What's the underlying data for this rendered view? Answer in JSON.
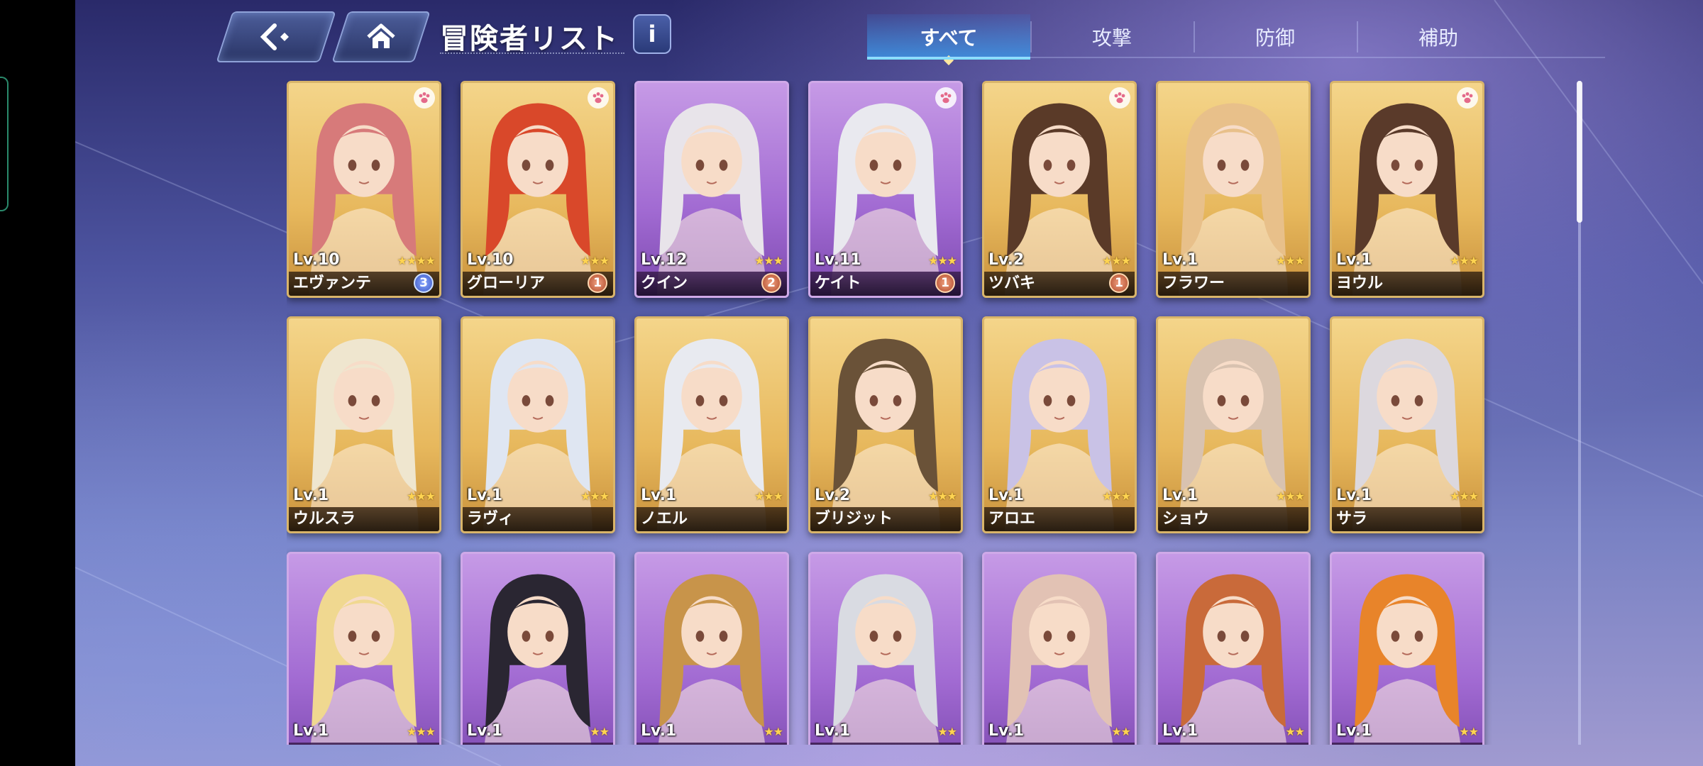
{
  "header": {
    "title": "冒険者リスト",
    "info_label": "i"
  },
  "tabs": [
    {
      "label": "すべて",
      "active": true
    },
    {
      "label": "攻撃",
      "active": false
    },
    {
      "label": "防御",
      "active": false
    },
    {
      "label": "補助",
      "active": false
    }
  ],
  "colors": {
    "gold_card": "#e7b85d",
    "purple_card": "#a16ad2",
    "tab_active": "#3c96e6"
  },
  "cards": [
    {
      "level": "Lv.10",
      "name": "エヴァンテ",
      "stars": "★★★★",
      "badge": "3",
      "badge_style": "blue",
      "paw": true,
      "color": "gold",
      "hair": "#d77a7a"
    },
    {
      "level": "Lv.10",
      "name": "グローリア",
      "stars": "★★★",
      "badge": "1",
      "badge_style": "red",
      "paw": true,
      "color": "gold",
      "hair": "#d9482a"
    },
    {
      "level": "Lv.12",
      "name": "クイン",
      "stars": "★★★",
      "badge": "2",
      "badge_style": "red",
      "paw": false,
      "color": "purple",
      "hair": "#e8e4ea"
    },
    {
      "level": "Lv.11",
      "name": "ケイト",
      "stars": "★★★",
      "badge": "1",
      "badge_style": "red",
      "paw": true,
      "color": "purple",
      "hair": "#e9e9ef"
    },
    {
      "level": "Lv.2",
      "name": "ツバキ",
      "stars": "★★★",
      "badge": "1",
      "badge_style": "red",
      "paw": true,
      "color": "gold",
      "hair": "#5a3a28"
    },
    {
      "level": "Lv.1",
      "name": "フラワー",
      "stars": "★★★",
      "badge": "",
      "badge_style": "",
      "paw": false,
      "color": "gold",
      "hair": "#e8c08a"
    },
    {
      "level": "Lv.1",
      "name": "ヨウル",
      "stars": "★★★",
      "badge": "",
      "badge_style": "",
      "paw": true,
      "color": "gold",
      "hair": "#5a3a2a"
    },
    {
      "level": "Lv.1",
      "name": "ウルスラ",
      "stars": "★★★",
      "badge": "",
      "badge_style": "",
      "paw": false,
      "color": "gold",
      "hair": "#efe6cf"
    },
    {
      "level": "Lv.1",
      "name": "ラヴィ",
      "stars": "★★★",
      "badge": "",
      "badge_style": "",
      "paw": false,
      "color": "gold",
      "hair": "#dfe6f2"
    },
    {
      "level": "Lv.1",
      "name": "ノエル",
      "stars": "★★★",
      "badge": "",
      "badge_style": "",
      "paw": false,
      "color": "gold",
      "hair": "#e8eaf0"
    },
    {
      "level": "Lv.2",
      "name": "ブリジット",
      "stars": "★★★",
      "badge": "",
      "badge_style": "",
      "paw": false,
      "color": "gold",
      "hair": "#6a5238"
    },
    {
      "level": "Lv.1",
      "name": "アロエ",
      "stars": "★★★",
      "badge": "",
      "badge_style": "",
      "paw": false,
      "color": "gold",
      "hair": "#c9c2e6"
    },
    {
      "level": "Lv.1",
      "name": "ショウ",
      "stars": "★★★",
      "badge": "",
      "badge_style": "",
      "paw": false,
      "color": "gold",
      "hair": "#d8c2b0"
    },
    {
      "level": "Lv.1",
      "name": "サラ",
      "stars": "★★★",
      "badge": "",
      "badge_style": "",
      "paw": false,
      "color": "gold",
      "hair": "#dcd8de"
    },
    {
      "level": "Lv.1",
      "name": "",
      "stars": "★★★",
      "badge": "",
      "badge_style": "",
      "paw": false,
      "color": "purple",
      "hair": "#f0d890"
    },
    {
      "level": "Lv.1",
      "name": "",
      "stars": "★★",
      "badge": "",
      "badge_style": "",
      "paw": false,
      "color": "purple",
      "hair": "#2a2632"
    },
    {
      "level": "Lv.1",
      "name": "",
      "stars": "★★",
      "badge": "",
      "badge_style": "",
      "paw": false,
      "color": "purple",
      "hair": "#c8944a"
    },
    {
      "level": "Lv.1",
      "name": "",
      "stars": "★★",
      "badge": "",
      "badge_style": "",
      "paw": false,
      "color": "purple",
      "hair": "#d9dbe2"
    },
    {
      "level": "Lv.1",
      "name": "",
      "stars": "★★",
      "badge": "",
      "badge_style": "",
      "paw": false,
      "color": "purple",
      "hair": "#e2c2b4"
    },
    {
      "level": "Lv.1",
      "name": "",
      "stars": "★★",
      "badge": "",
      "badge_style": "",
      "paw": false,
      "color": "purple",
      "hair": "#c96a3a"
    },
    {
      "level": "Lv.1",
      "name": "",
      "stars": "★★",
      "badge": "",
      "badge_style": "",
      "paw": false,
      "color": "purple",
      "hair": "#e8842a"
    }
  ]
}
